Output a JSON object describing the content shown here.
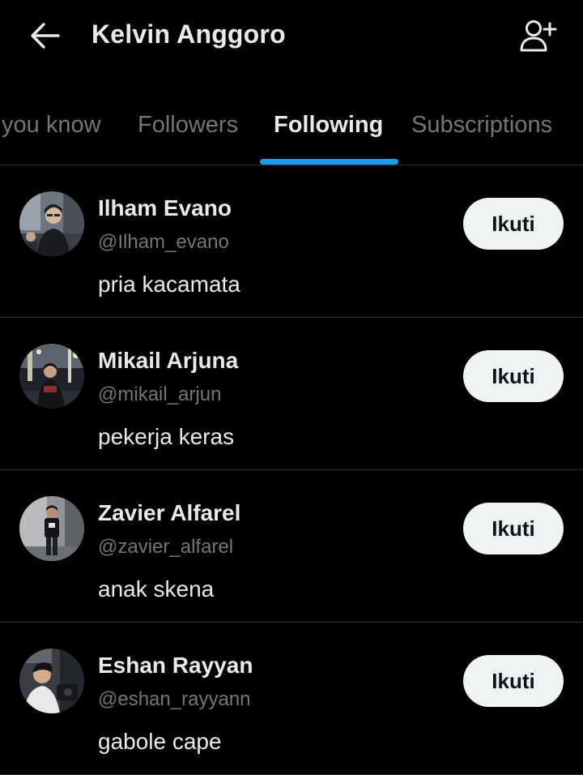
{
  "header": {
    "title": "Kelvin Anggoro",
    "back_icon": "arrow-left-icon",
    "add_user_icon": "add-user-icon"
  },
  "tabs": [
    {
      "label": "you know",
      "active": false
    },
    {
      "label": "Followers",
      "active": false
    },
    {
      "label": "Following",
      "active": true
    },
    {
      "label": "Subscriptions",
      "active": false
    }
  ],
  "colors": {
    "background": "#000000",
    "accent": "#1d9bf0",
    "text_primary": "#e7e9ea",
    "text_secondary": "#71767b",
    "button_bg": "#eff3f4",
    "button_text": "#0f1419",
    "divider": "#2f3336"
  },
  "users": [
    {
      "name": "Ilham Evano",
      "handle": "@Ilham_evano",
      "bio": "pria kacamata",
      "button_label": "Ikuti"
    },
    {
      "name": "Mikail Arjuna",
      "handle": "@mikail_arjun",
      "bio": "pekerja keras",
      "button_label": "Ikuti"
    },
    {
      "name": "Zavier Alfarel",
      "handle": "@zavier_alfarel",
      "bio": "anak skena",
      "button_label": "Ikuti"
    },
    {
      "name": "Eshan Rayyan",
      "handle": "@eshan_rayyann",
      "bio": "gabole cape",
      "button_label": "Ikuti"
    }
  ]
}
